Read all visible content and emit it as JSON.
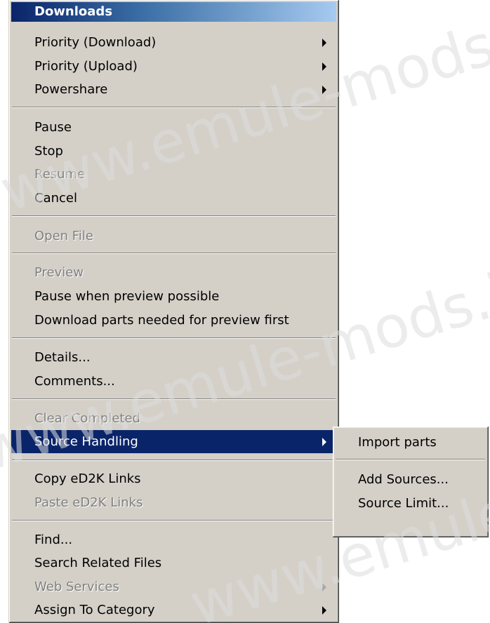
{
  "watermark": {
    "text": "www.emule-mods.it"
  },
  "menu": {
    "title": "Downloads",
    "items": {
      "priority_download": {
        "label": "Priority (Download)",
        "has_submenu": true,
        "enabled": true
      },
      "priority_upload": {
        "label": "Priority (Upload)",
        "has_submenu": true,
        "enabled": true
      },
      "powershare": {
        "label": "Powershare",
        "has_submenu": true,
        "enabled": true
      },
      "pause": {
        "label": "Pause",
        "enabled": true
      },
      "stop": {
        "label": "Stop",
        "enabled": true
      },
      "resume": {
        "label": "Resume",
        "enabled": false
      },
      "cancel": {
        "label": "Cancel",
        "enabled": true
      },
      "open_file": {
        "label": "Open File",
        "enabled": false
      },
      "preview": {
        "label": "Preview",
        "enabled": false
      },
      "pause_when_preview": {
        "label": "Pause when preview possible",
        "enabled": true
      },
      "download_parts_preview": {
        "label": "Download parts needed for preview first",
        "enabled": true
      },
      "details": {
        "label": "Details...",
        "enabled": true
      },
      "comments": {
        "label": "Comments...",
        "enabled": true
      },
      "clear_completed": {
        "label": "Clear Completed",
        "enabled": false
      },
      "source_handling": {
        "label": "Source Handling",
        "has_submenu": true,
        "enabled": true,
        "selected": true
      },
      "copy_ed2k": {
        "label": "Copy eD2K Links",
        "enabled": true
      },
      "paste_ed2k": {
        "label": "Paste eD2K Links",
        "enabled": false
      },
      "find": {
        "label": "Find...",
        "enabled": true
      },
      "search_related": {
        "label": "Search Related Files",
        "enabled": true
      },
      "web_services": {
        "label": "Web Services",
        "has_submenu": true,
        "enabled": false
      },
      "assign_category": {
        "label": "Assign To Category",
        "has_submenu": true,
        "enabled": true
      }
    }
  },
  "submenu": {
    "items": {
      "import_parts": {
        "label": "Import parts"
      },
      "add_sources": {
        "label": "Add Sources..."
      },
      "source_limit": {
        "label": "Source Limit..."
      }
    }
  },
  "colors": {
    "menu_bg": "#d4d0c8",
    "highlight": "#0a246a",
    "disabled_text": "#808080"
  }
}
